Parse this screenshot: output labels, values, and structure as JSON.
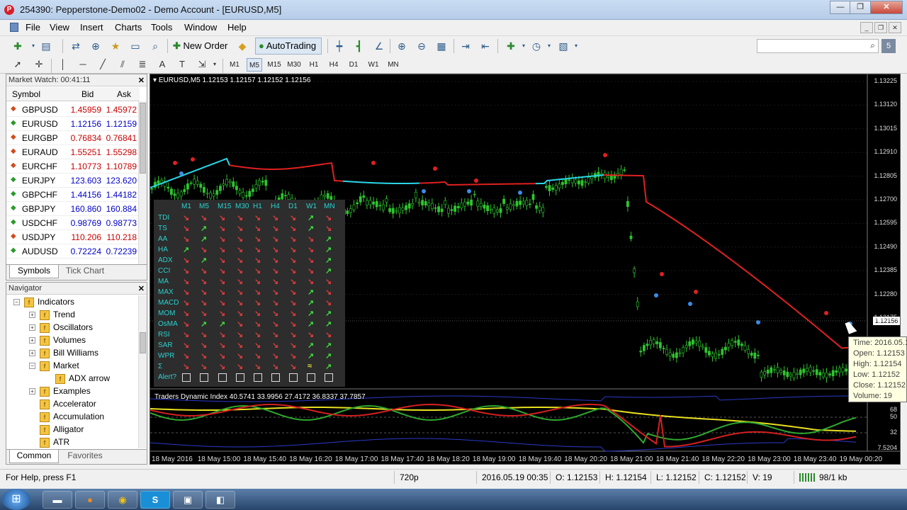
{
  "window": {
    "title": "254390: Pepperstone-Demo02 - Demo Account - [EURUSD,M5]",
    "icon": "P",
    "minimize": "—",
    "maximize": "❐",
    "close": "✕"
  },
  "menu": [
    "File",
    "View",
    "Insert",
    "Charts",
    "Tools",
    "Window",
    "Help"
  ],
  "toolbar": {
    "new_order": "New Order",
    "autotrading": "AutoTrading",
    "timeframes": [
      "M1",
      "M5",
      "M15",
      "M30",
      "H1",
      "H4",
      "D1",
      "W1",
      "MN"
    ],
    "active_timeframe": "M5",
    "search_placeholder": ""
  },
  "market_watch": {
    "title": "Market Watch: 00:41:11",
    "headers": [
      "Symbol",
      "Bid",
      "Ask"
    ],
    "rows": [
      {
        "symbol": "GBPUSD",
        "bid": "1.45959",
        "ask": "1.45972",
        "dir": "down"
      },
      {
        "symbol": "EURUSD",
        "bid": "1.12156",
        "ask": "1.12159",
        "dir": "up"
      },
      {
        "symbol": "EURGBP",
        "bid": "0.76834",
        "ask": "0.76841",
        "dir": "down"
      },
      {
        "symbol": "EURAUD",
        "bid": "1.55251",
        "ask": "1.55298",
        "dir": "down"
      },
      {
        "symbol": "EURCHF",
        "bid": "1.10773",
        "ask": "1.10789",
        "dir": "down"
      },
      {
        "symbol": "EURJPY",
        "bid": "123.603",
        "ask": "123.620",
        "dir": "up"
      },
      {
        "symbol": "GBPCHF",
        "bid": "1.44156",
        "ask": "1.44182",
        "dir": "up"
      },
      {
        "symbol": "GBPJPY",
        "bid": "160.860",
        "ask": "160.884",
        "dir": "up"
      },
      {
        "symbol": "USDCHF",
        "bid": "0.98769",
        "ask": "0.98773",
        "dir": "up"
      },
      {
        "symbol": "USDJPY",
        "bid": "110.206",
        "ask": "110.218",
        "dir": "down"
      },
      {
        "symbol": "AUDUSD",
        "bid": "0.72224",
        "ask": "0.72239",
        "dir": "up"
      }
    ],
    "tabs": [
      "Symbols",
      "Tick Chart"
    ]
  },
  "navigator": {
    "title": "Navigator",
    "tabs": [
      "Common",
      "Favorites"
    ],
    "items": [
      {
        "label": "Indicators",
        "level": 0,
        "exp": "−"
      },
      {
        "label": "Trend",
        "level": 1,
        "exp": "+"
      },
      {
        "label": "Oscillators",
        "level": 1,
        "exp": "+"
      },
      {
        "label": "Volumes",
        "level": 1,
        "exp": "+"
      },
      {
        "label": "Bill Williams",
        "level": 1,
        "exp": "+"
      },
      {
        "label": "Market",
        "level": 1,
        "exp": "−"
      },
      {
        "label": "ADX arrow",
        "level": 2,
        "exp": ""
      },
      {
        "label": "Examples",
        "level": 1,
        "exp": "+"
      },
      {
        "label": "Accelerator",
        "level": 1,
        "exp": ""
      },
      {
        "label": "Accumulation",
        "level": 1,
        "exp": ""
      },
      {
        "label": "Alligator",
        "level": 1,
        "exp": ""
      },
      {
        "label": "ATR",
        "level": 1,
        "exp": ""
      }
    ]
  },
  "chart": {
    "title": "EURUSD,M5  1.12153 1.12157 1.12152 1.12156",
    "subwindow_title": "Traders Dynamic Index 40.5741 33.9956 27.4172 36.8337 37.7857",
    "y_labels": [
      "1.13225",
      "1.13120",
      "1.13015",
      "1.12910",
      "1.12805",
      "1.12700",
      "1.12595",
      "1.12490",
      "1.12385",
      "1.12280",
      "1.12175"
    ],
    "current_price": "1.12156",
    "sub_y_labels": [
      "97.2497",
      "68",
      "50",
      "32",
      "7.5204"
    ],
    "x_labels": [
      "18 May 2016",
      "18 May 15:00",
      "18 May 15:40",
      "18 May 16:20",
      "18 May 17:00",
      "18 May 17:40",
      "18 May 18:20",
      "18 May 19:00",
      "18 May 19:40",
      "18 May 20:20",
      "18 May 21:00",
      "18 May 21:40",
      "18 May 22:20",
      "18 May 23:00",
      "18 May 23:40",
      "19 May 00:20"
    ],
    "colors": {
      "ma_up": "#2ad6e8",
      "ma_down": "#e02020",
      "candle": "#2fc42f",
      "signal_up": "#3a8ce8",
      "signal_down": "#e02020"
    }
  },
  "dashboard": {
    "timeframes": [
      "M1",
      "M5",
      "M15",
      "M30",
      "H1",
      "H4",
      "D1",
      "W1",
      "MN"
    ],
    "rows": [
      {
        "name": "TDI",
        "cells": "rrrrrrrgr"
      },
      {
        "name": "TS",
        "cells": "rgrrrrrgr"
      },
      {
        "name": "AA",
        "cells": "rgrrrrrrg"
      },
      {
        "name": "HA",
        "cells": "grrrrrrrg"
      },
      {
        "name": "ADX",
        "cells": "rgrrrrrrg"
      },
      {
        "name": "CCI",
        "cells": "rrrrrrrrg"
      },
      {
        "name": "MA",
        "cells": "rrrrrrrrr"
      },
      {
        "name": "MAX",
        "cells": "rrrrrrrgr"
      },
      {
        "name": "MACD",
        "cells": "rrrrrrrgr"
      },
      {
        "name": "MOM",
        "cells": "rrrrrrrgg"
      },
      {
        "name": "OsMA",
        "cells": "rggrrrrgg"
      },
      {
        "name": "RSI",
        "cells": "rrrrrrrrr"
      },
      {
        "name": "SAR",
        "cells": "rrrrrrrgg"
      },
      {
        "name": "WPR",
        "cells": "rrrrrrrgg"
      },
      {
        "name": "Σ",
        "cells": "rrrrrrryg"
      }
    ],
    "alert_label": "Alert?"
  },
  "tooltip": {
    "time": "Time: 2016.05.19 00:35",
    "open": "Open: 1.12153",
    "high": "High: 1.12154",
    "low": "Low: 1.12152",
    "close": "Close: 1.12152",
    "volume": "Volume: 19"
  },
  "status": {
    "help": "For Help, press F1",
    "profile": "720p",
    "datetime": "2016.05.19 00:35",
    "open": "O: 1.12153",
    "high": "H: 1.12154",
    "low": "L: 1.12152",
    "close": "C: 1.12152",
    "volume": "V: 19",
    "traffic": "98/1 kb"
  },
  "taskbar": {
    "apps": [
      "explorer-icon",
      "firefox-icon",
      "chrome-icon",
      "skype-icon",
      "window-icon",
      "app-icon"
    ]
  }
}
